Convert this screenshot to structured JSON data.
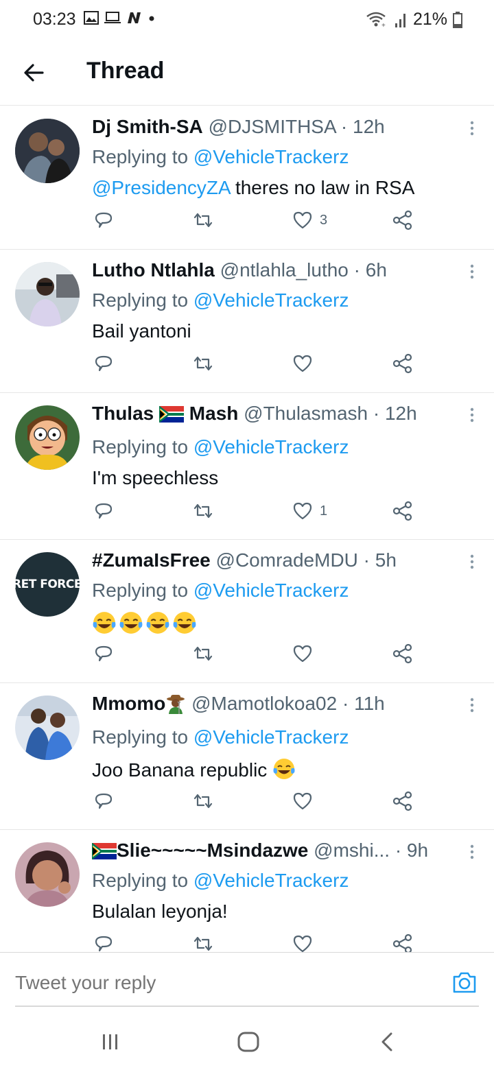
{
  "status_bar": {
    "time": "03:23",
    "left_icons": [
      "image-icon",
      "laptop-icon",
      "n-app-icon",
      "dot-icon"
    ],
    "right_icons": [
      "wifi-icon",
      "signal-icon",
      "battery-icon"
    ],
    "battery": "21%"
  },
  "header": {
    "back_icon": "arrow-left-icon",
    "title": "Thread"
  },
  "replying_prefix": "Replying to",
  "tweets": [
    {
      "name": "Dj Smith-SA",
      "handle": "@DJSMITHSA",
      "time": "· 12h",
      "reply_to": "@VehicleTrackerz",
      "mention": "@PresidencyZA",
      "text": " theres no law in RSA",
      "likes": "3",
      "avatar_color": "#3b4a5a"
    },
    {
      "name": "Lutho Ntlahla",
      "handle": "@ntlahla_lutho",
      "time": "· 6h",
      "reply_to": "@VehicleTrackerz",
      "text": "Bail yantoni",
      "likes": "",
      "avatar_color": "#8aa0b0"
    },
    {
      "name_a": "Thulas",
      "name_b": "Mash",
      "handle": "@Thulasmash",
      "time": "· 12h",
      "reply_to": "@VehicleTrackerz",
      "text": "I'm speechless",
      "likes": "1",
      "avatar_color": "#3d6b3a"
    },
    {
      "name": "#ZumaIsFree",
      "handle": "@ComradeMDU",
      "time": "· 5h",
      "reply_to": "@VehicleTrackerz",
      "avatar_text": "RET FORCES",
      "emoji_count": 4,
      "likes": "",
      "avatar_color": "#1f3038"
    },
    {
      "name": "Mmomo",
      "handle": "@Mamotlokoa02",
      "time": "· 11h",
      "reply_to": "@VehicleTrackerz",
      "text": "Joo Banana republic ",
      "likes": "",
      "avatar_color": "#2e5fa8"
    },
    {
      "name": "Slie~~~~~Msindazwe",
      "handle": "@mshi...",
      "time": "· 9h",
      "reply_to": "@VehicleTrackerz",
      "text": "Bulalan leyonja!",
      "likes": "",
      "avatar_color": "#9b6e7a"
    }
  ],
  "composer": {
    "placeholder": "Tweet your reply",
    "camera_icon": "camera-icon"
  },
  "navbar": {
    "icons": [
      "recent-apps-icon",
      "home-icon",
      "back-icon"
    ]
  },
  "colors": {
    "accent": "#1d9bf0",
    "secondary_text": "#536471",
    "divider": "#e6e6e6"
  }
}
